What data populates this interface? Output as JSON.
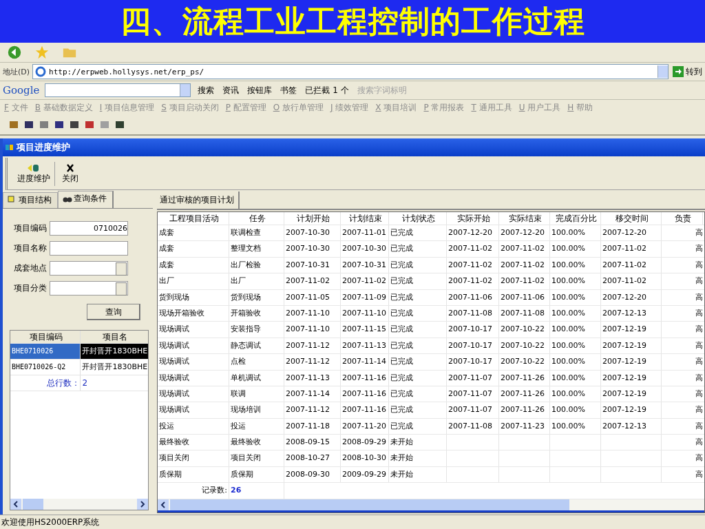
{
  "slide_title": "四、流程工业工程控制的工作过程",
  "address_bar": {
    "label": "地址(D)",
    "url": "http://erpweb.hollysys.net/erp_ps/",
    "go": "转到"
  },
  "google_bar": {
    "logo": "Google",
    "search": "搜索",
    "items": [
      {
        "label": "资讯",
        "disabled": false
      },
      {
        "label": "按钮库",
        "disabled": false
      },
      {
        "label": "书签",
        "disabled": false
      },
      {
        "label": "已拦截 1 个",
        "disabled": false
      },
      {
        "label": "搜索字词标明",
        "disabled": true
      }
    ]
  },
  "menu": [
    {
      "key": "F",
      "label": "文件"
    },
    {
      "key": "B",
      "label": "基础数据定义"
    },
    {
      "key": "I",
      "label": "项目信息管理"
    },
    {
      "key": "S",
      "label": "项目启动关闭"
    },
    {
      "key": "P",
      "label": "配置管理"
    },
    {
      "key": "O",
      "label": "放行单管理"
    },
    {
      "key": "J",
      "label": "绩效管理"
    },
    {
      "key": "X",
      "label": "项目培训"
    },
    {
      "key": "P",
      "label": "常用报表"
    },
    {
      "key": "T",
      "label": "通用工具"
    },
    {
      "key": "U",
      "label": "用户工具"
    },
    {
      "key": "H",
      "label": "帮助"
    }
  ],
  "window": {
    "title": "项目进度维护"
  },
  "toolbar": [
    {
      "kind": "progress",
      "label": "进度维护"
    },
    {
      "kind": "close",
      "label": "关闭"
    }
  ],
  "left_tabs": [
    {
      "label": "项目结构",
      "selected": false
    },
    {
      "label": "查询条件",
      "selected": true
    }
  ],
  "query": {
    "fields": [
      {
        "kind": "text",
        "label": "项目编码",
        "value": "0710026"
      },
      {
        "kind": "text",
        "label": "项目名称"
      },
      {
        "kind": "select",
        "label": "成套地点"
      },
      {
        "kind": "select",
        "label": "项目分类"
      }
    ],
    "button": "查询"
  },
  "project_grid": {
    "columns": [
      "项目编码",
      "项目名"
    ],
    "rows": [
      {
        "code": "BHE0710026",
        "name": "开封晋开1830BHE",
        "selected": true
      },
      {
        "code": "BHE0710026-Q2",
        "name": "开封晋开1830BHE",
        "selected": false
      }
    ],
    "total_label": "总行数：",
    "total": "2"
  },
  "right_tab": "通过审核的项目计划",
  "plan_table": {
    "columns": [
      "工程项目活动",
      "任务",
      "计划开始",
      "计划结束",
      "计划状态",
      "实际开始",
      "实际结束",
      "完成百分比",
      "移交时间",
      "负责"
    ],
    "rows": [
      [
        "成套",
        "联调检查",
        "2007-10-30",
        "2007-11-01",
        "已完成",
        "2007-12-20",
        "2007-12-20",
        "100.00%",
        "2007-12-20",
        "高"
      ],
      [
        "成套",
        "整理文档",
        "2007-10-30",
        "2007-10-30",
        "已完成",
        "2007-11-02",
        "2007-11-02",
        "100.00%",
        "2007-11-02",
        "高"
      ],
      [
        "成套",
        "出厂检验",
        "2007-10-31",
        "2007-10-31",
        "已完成",
        "2007-11-02",
        "2007-11-02",
        "100.00%",
        "2007-11-02",
        "高"
      ],
      [
        "出厂",
        "出厂",
        "2007-11-02",
        "2007-11-02",
        "已完成",
        "2007-11-02",
        "2007-11-02",
        "100.00%",
        "2007-11-02",
        "高"
      ],
      [
        "货到现场",
        "货到现场",
        "2007-11-05",
        "2007-11-09",
        "已完成",
        "2007-11-06",
        "2007-11-06",
        "100.00%",
        "2007-12-20",
        "高"
      ],
      [
        "现场开箱验收",
        "开箱验收",
        "2007-11-10",
        "2007-11-10",
        "已完成",
        "2007-11-08",
        "2007-11-08",
        "100.00%",
        "2007-12-13",
        "高"
      ],
      [
        "现场调试",
        "安装指导",
        "2007-11-10",
        "2007-11-15",
        "已完成",
        "2007-10-17",
        "2007-10-22",
        "100.00%",
        "2007-12-19",
        "高"
      ],
      [
        "现场调试",
        "静态调试",
        "2007-11-12",
        "2007-11-13",
        "已完成",
        "2007-10-17",
        "2007-10-22",
        "100.00%",
        "2007-12-19",
        "高"
      ],
      [
        "现场调试",
        "点检",
        "2007-11-12",
        "2007-11-14",
        "已完成",
        "2007-10-17",
        "2007-10-22",
        "100.00%",
        "2007-12-19",
        "高"
      ],
      [
        "现场调试",
        "单机调试",
        "2007-11-13",
        "2007-11-16",
        "已完成",
        "2007-11-07",
        "2007-11-26",
        "100.00%",
        "2007-12-19",
        "高"
      ],
      [
        "现场调试",
        "联调",
        "2007-11-14",
        "2007-11-16",
        "已完成",
        "2007-11-07",
        "2007-11-26",
        "100.00%",
        "2007-12-19",
        "高"
      ],
      [
        "现场调试",
        "现场培训",
        "2007-11-12",
        "2007-11-16",
        "已完成",
        "2007-11-07",
        "2007-11-26",
        "100.00%",
        "2007-12-19",
        "高"
      ],
      [
        "投运",
        "投运",
        "2007-11-18",
        "2007-11-20",
        "已完成",
        "2007-11-08",
        "2007-11-23",
        "100.00%",
        "2007-12-13",
        "高"
      ],
      [
        "最终验收",
        "最终验收",
        "2008-09-15",
        "2008-09-29",
        "未开始",
        null,
        null,
        null,
        null,
        "高"
      ],
      [
        "项目关闭",
        "项目关闭",
        "2008-10-27",
        "2008-10-30",
        "未开始",
        null,
        null,
        null,
        null,
        "高"
      ],
      [
        "质保期",
        "质保期",
        "2008-09-30",
        "2009-09-29",
        "未开始",
        null,
        null,
        null,
        null,
        "高"
      ]
    ],
    "count_label": "记录数:",
    "count": "26"
  },
  "status_bar": "欢迎使用HS2000ERP系统"
}
